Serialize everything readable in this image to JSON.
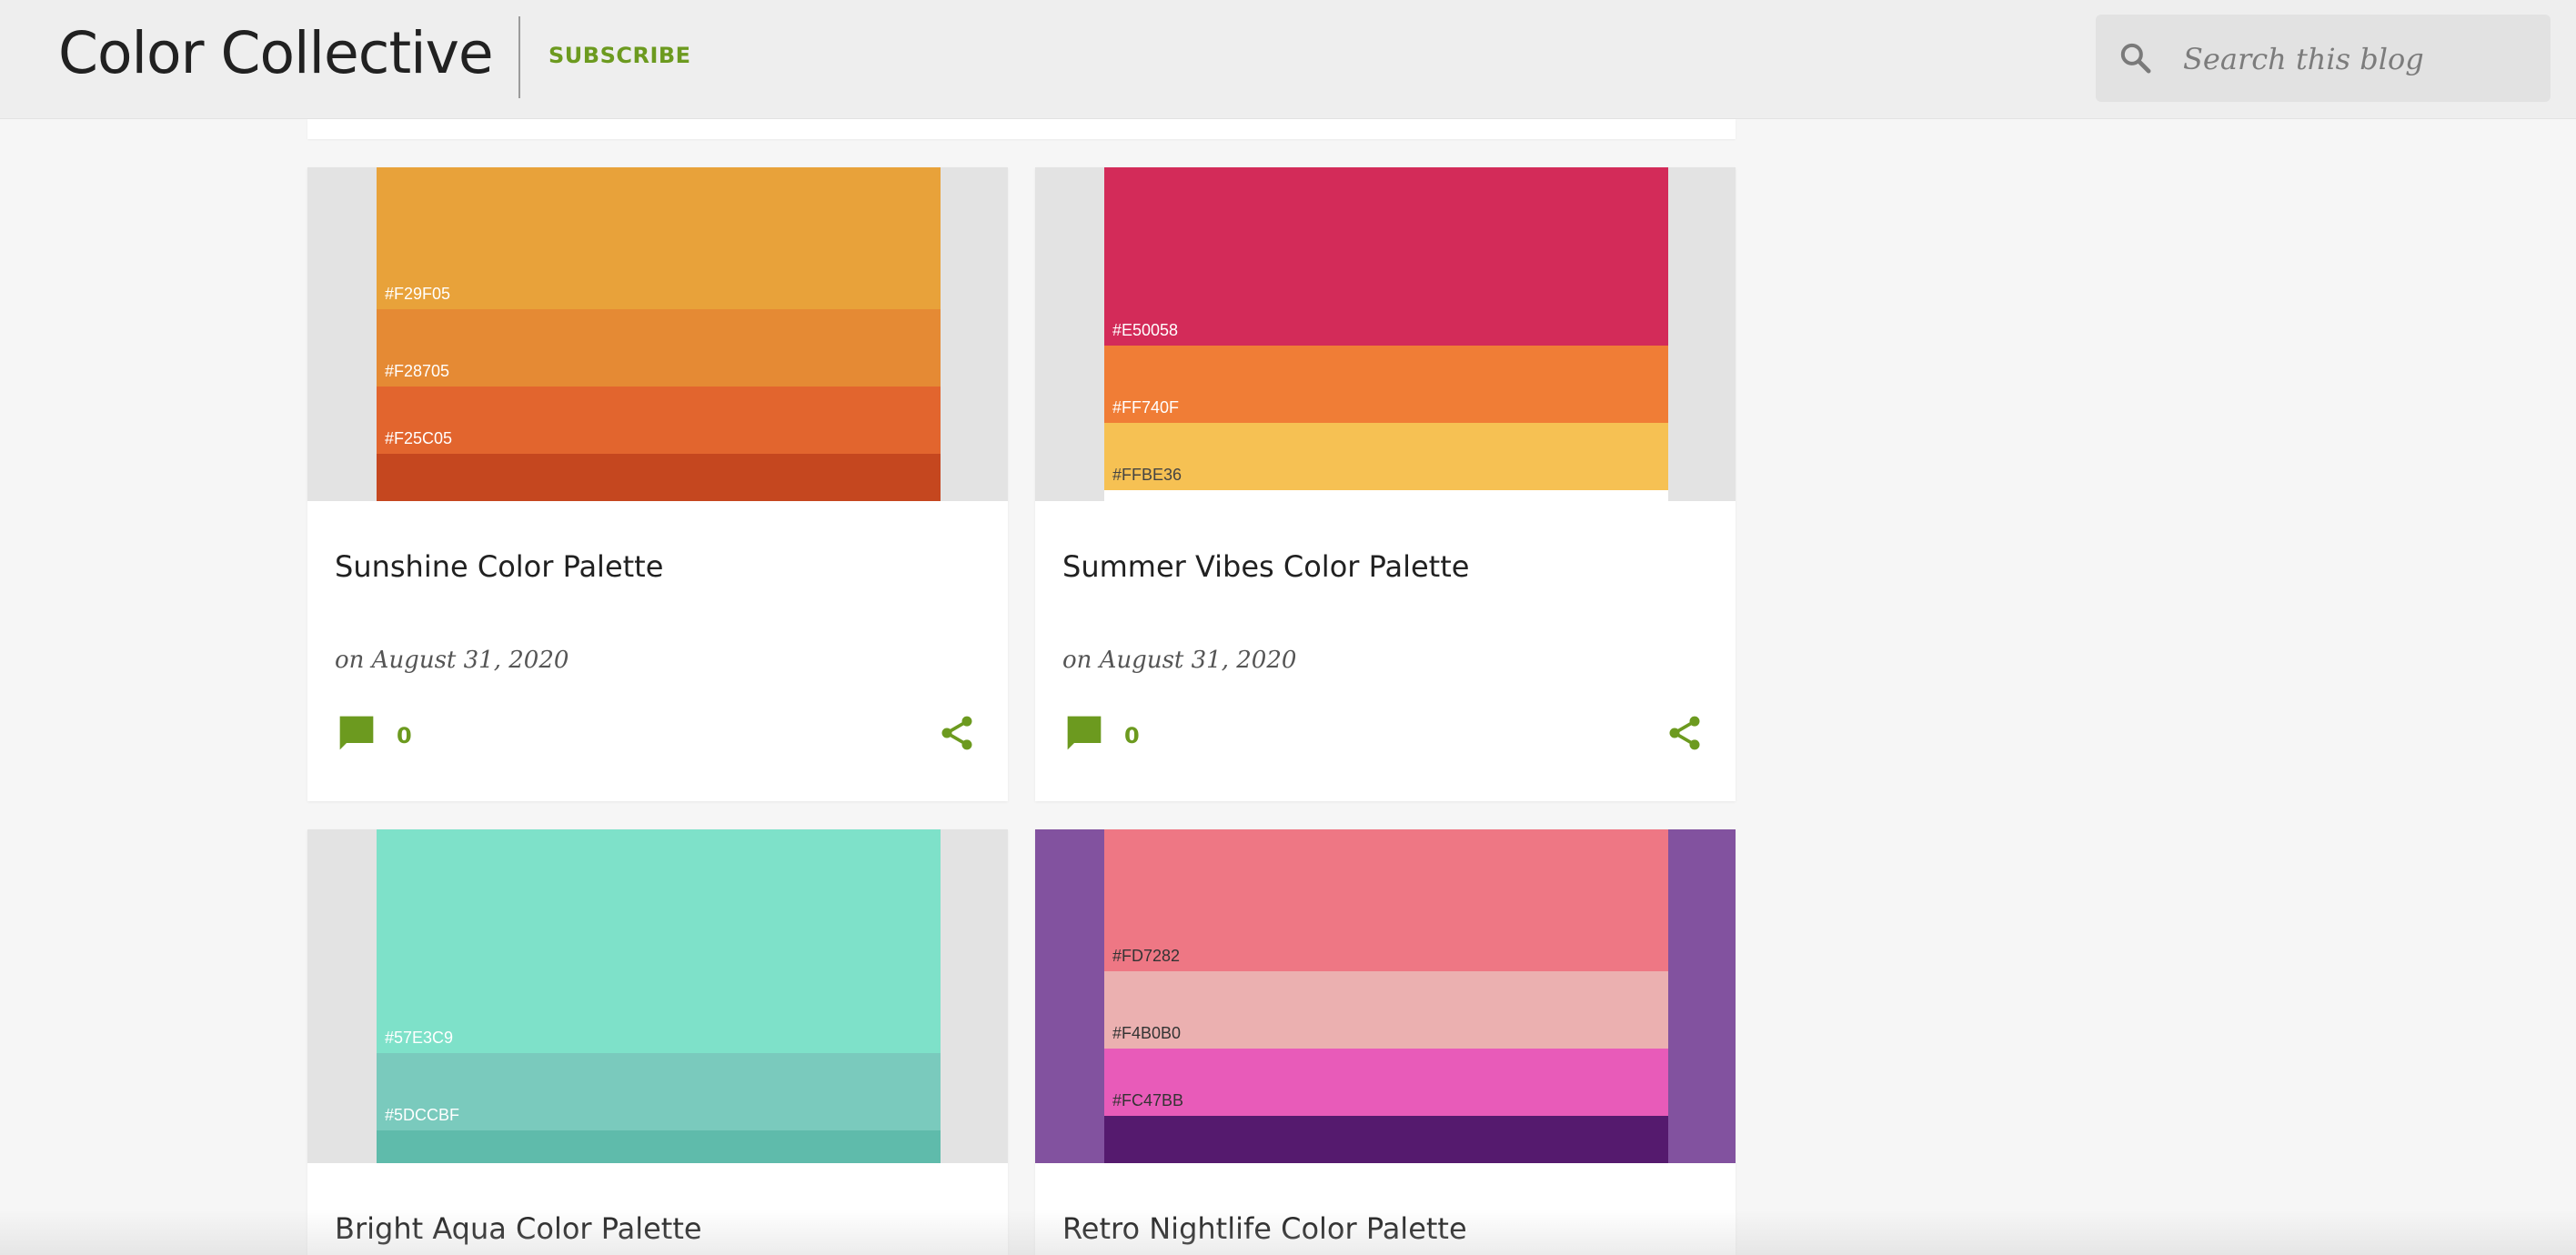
{
  "header": {
    "blog_title": "Color Collective",
    "subscribe_label": "SUBSCRIBE",
    "search_placeholder": "Search this blog"
  },
  "colors": {
    "accent": "#6c9a1f",
    "page_bg": "#f6f6f6",
    "header_bg": "#eeeeee"
  },
  "posts": [
    {
      "title": "Sunshine Color Palette",
      "date": "on August 31, 2020",
      "comment_count": "0",
      "side_color": "#e3e3e3",
      "bands": [
        {
          "color": "#e8a23a",
          "label": "#F29F05",
          "label_color": "#ffffff"
        },
        {
          "color": "#e58a34",
          "label": "#F28705",
          "label_color": "#ffffff"
        },
        {
          "color": "#e2652e",
          "label": "#F25C05",
          "label_color": "#ffffff"
        },
        {
          "color": "#c5471f",
          "label": "",
          "label_color": "#ffffff"
        }
      ]
    },
    {
      "title": "Summer Vibes Color Palette",
      "date": "on August 31, 2020",
      "comment_count": "0",
      "side_color": "#e3e3e3",
      "bands": [
        {
          "color": "#d32b59",
          "label": "#E50058",
          "label_color": "#ffffff"
        },
        {
          "color": "#f07d36",
          "label": "#FF740F",
          "label_color": "#ffffff"
        },
        {
          "color": "#f6c153",
          "label": "#FFBE36",
          "label_color": "#444444"
        },
        {
          "color": "#ffffff",
          "label": "",
          "label_color": "#444444"
        }
      ]
    },
    {
      "title": "Bright Aqua Color Palette",
      "date": "",
      "comment_count": "",
      "side_color": "#e3e3e3",
      "bands": [
        {
          "color": "#7ee1c9",
          "label": "#57E3C9",
          "label_color": "#ffffff"
        },
        {
          "color": "#7acabd",
          "label": "#5DCCBF",
          "label_color": "#ffffff"
        },
        {
          "color": "#5fbbab",
          "label": "",
          "label_color": "#ffffff"
        }
      ]
    },
    {
      "title": "Retro Nightlife Color Palette",
      "date": "",
      "comment_count": "",
      "side_color": "#82529f",
      "bands": [
        {
          "color": "#ee7784",
          "label": "#FD7282",
          "label_color": "#333333"
        },
        {
          "color": "#ebb0b0",
          "label": "#F4B0B0",
          "label_color": "#333333"
        },
        {
          "color": "#e85bb9",
          "label": "#FC47BB",
          "label_color": "#333333"
        },
        {
          "color": "#551a6e",
          "label": "",
          "label_color": "#ffffff"
        }
      ]
    }
  ]
}
